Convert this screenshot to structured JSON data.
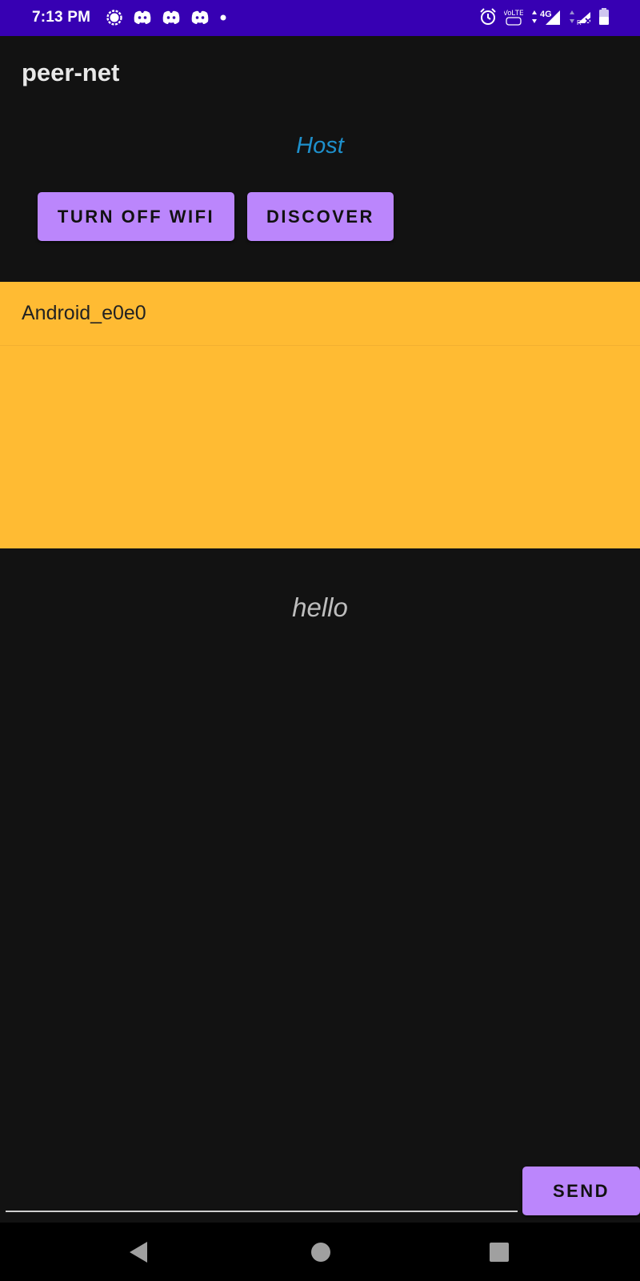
{
  "status_bar": {
    "time": "7:13 PM",
    "notification_icons": [
      "signal-messenger-icon",
      "discord-icon",
      "discord-icon",
      "discord-icon",
      "more-dot-icon"
    ],
    "system_icons": [
      "alarm-icon",
      "volte-icon",
      "4g-data-icon",
      "signal-strength-icon",
      "roaming-signal-icon",
      "battery-icon"
    ],
    "volte_label": "VoLTE",
    "network_label": "4G",
    "roaming_label": "R",
    "color": "#3700b3"
  },
  "app": {
    "title": "peer-net",
    "role": "Host",
    "role_color": "#1e90cc"
  },
  "controls": {
    "wifi_button": "TURN OFF WIFI",
    "discover_button": "DISCOVER",
    "button_color": "#bb86fc"
  },
  "peers": {
    "background": "#ffbb33",
    "items": [
      {
        "name": "Android_e0e0"
      }
    ]
  },
  "conversation": {
    "message": "hello"
  },
  "composer": {
    "input_value": "",
    "send_button": "SEND"
  },
  "nav_bar": {
    "icons": [
      "back-icon",
      "home-icon",
      "recents-icon"
    ]
  }
}
